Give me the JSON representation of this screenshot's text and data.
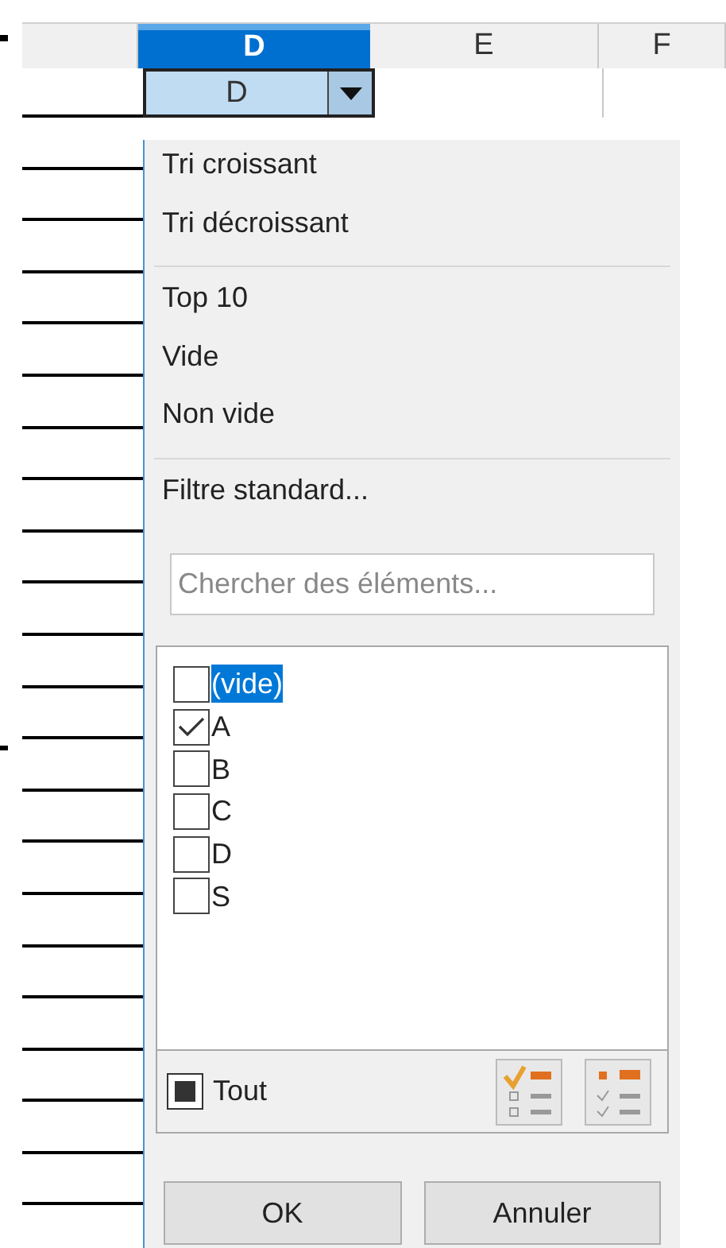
{
  "columns": [
    {
      "label": "D",
      "selected": true
    },
    {
      "label": "E",
      "selected": false
    },
    {
      "label": "F",
      "selected": false
    }
  ],
  "header_cell": {
    "label": "D"
  },
  "menu_groups": [
    [
      "Tri croissant",
      "Tri décroissant"
    ],
    [
      "Top 10",
      "Vide",
      "Non vide"
    ],
    [
      "Filtre standard..."
    ]
  ],
  "search": {
    "placeholder": "Chercher des éléments..."
  },
  "values": [
    {
      "label": "(vide)",
      "checked": false,
      "selected": true
    },
    {
      "label": "A",
      "checked": true,
      "selected": false
    },
    {
      "label": "B",
      "checked": false,
      "selected": false
    },
    {
      "label": "C",
      "checked": false,
      "selected": false
    },
    {
      "label": "D",
      "checked": false,
      "selected": false
    },
    {
      "label": "S",
      "checked": false,
      "selected": false
    }
  ],
  "all": {
    "label": "Tout",
    "partial": true
  },
  "buttons": [
    "OK",
    "Annuler"
  ]
}
